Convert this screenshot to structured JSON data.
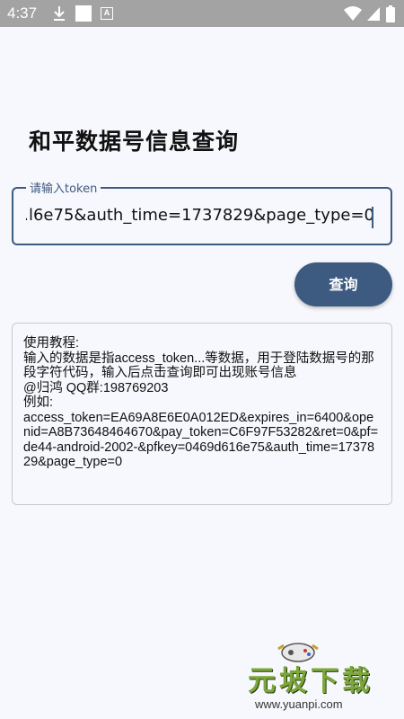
{
  "status_bar": {
    "time": "4:37",
    "icons": [
      "download-icon",
      "square-icon",
      "a-badge-icon",
      "wifi-icon",
      "signal-icon",
      "battery-icon"
    ],
    "a_badge": "A"
  },
  "page": {
    "title": "和平数据号信息查询"
  },
  "token_field": {
    "label": "请输入token",
    "value": "a=...l6e75&auth_time=1737829&page_type=0"
  },
  "query_button": {
    "label": "查询"
  },
  "instructions": {
    "lines": [
      "使用教程:",
      "输入的数据是指access_token...等数据，用于登陆数据号的那段字符代码，输入后点击查询即可出现账号信息",
      "@归鸿  QQ群:198769203",
      "例如:",
      "access_token=EA69A8E6E0A012ED&expires_in=6400&openid=A8B73648464670&pay_token=C6F97F53282&ret=0&pf=de44-android-2002-&pfkey=0469d616e75&auth_time=1737829&page_type=0"
    ]
  },
  "watermark": {
    "brand": "元坡下载",
    "url": "www.yuanpi.com"
  },
  "colors": {
    "accent": "#3d5a80",
    "background": "#f7f8fd",
    "status_bar": "#a3a3a3"
  }
}
